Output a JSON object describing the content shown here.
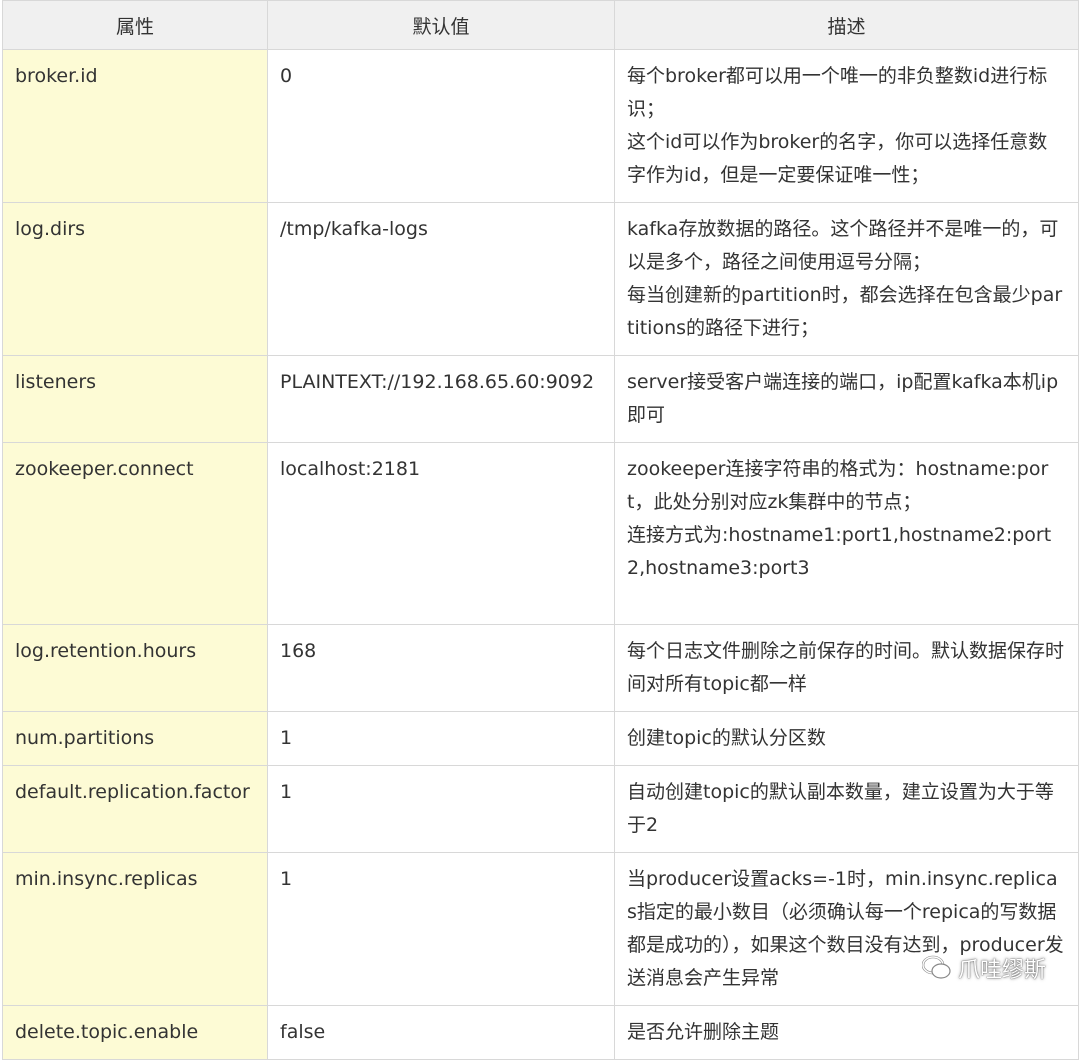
{
  "headers": [
    "属性",
    "默认值",
    "描述"
  ],
  "rows": [
    {
      "property": "broker.id",
      "default": "0",
      "description": [
        "每个broker都可以用一个唯一的非负整数id进行标识；",
        "这个id可以作为broker的名字，你可以选择任意数字作为id，但是一定要保证唯一性；"
      ]
    },
    {
      "property": "log.dirs",
      "default": "/tmp/kafka-logs",
      "description": [
        "kafka存放数据的路径。这个路径并不是唯一的，可以是多个，路径之间使用逗号分隔；",
        "每当创建新的partition时，都会选择在包含最少partitions的路径下进行；"
      ]
    },
    {
      "property": "listeners",
      "default": "PLAINTEXT://192.168.65.60:9092",
      "description": [
        "server接受客户端连接的端口，ip配置kafka本机ip即可"
      ]
    },
    {
      "property": "zookeeper.connect",
      "default": "localhost:2181",
      "description": [
        "zookeeper连接字符串的格式为：hostname:port，此处分别对应zk集群中的节点；",
        "连接方式为:hostname1:port1,hostname2:port2,hostname3:port3"
      ]
    },
    {
      "property": "log.retention.hours",
      "default": "168",
      "description": [
        "每个日志文件删除之前保存的时间。默认数据保存时间对所有topic都一样"
      ]
    },
    {
      "property": "num.partitions",
      "default": "1",
      "description": [
        "创建topic的默认分区数"
      ]
    },
    {
      "property": "default.replication.factor",
      "default": "1",
      "description": [
        "自动创建topic的默认副本数量，建立设置为大于等于2"
      ]
    },
    {
      "property": "min.insync.replicas",
      "default": "1",
      "description": [
        "当producer设置acks=-1时，min.insync.replicas指定的最小数目（必须确认每一个repica的写数据都是成功的），如果这个数目没有达到，producer发送消息会产生异常"
      ]
    },
    {
      "property": "delete.topic.enable",
      "default": "false",
      "description": [
        "是否允许删除主题"
      ]
    }
  ],
  "watermark": {
    "text": "爪哇缪斯",
    "icon": "wechat-icon"
  }
}
